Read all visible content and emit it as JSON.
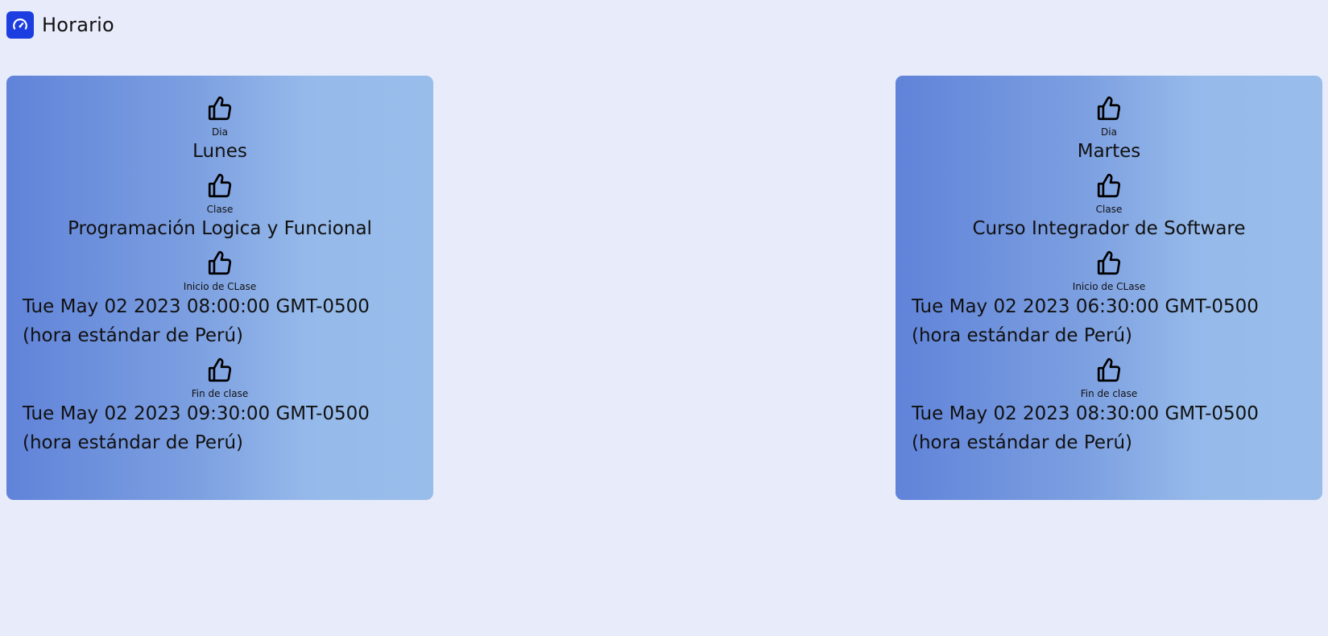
{
  "header": {
    "title": "Horario",
    "icon": "speedometer-icon",
    "icon_bg": "#1c3de0"
  },
  "cards": [
    {
      "dia_label": "Dia",
      "dia_value": "Lunes",
      "clase_label": "Clase",
      "clase_value": "Programación Logica y Funcional",
      "inicio_label": "Inicio de CLase",
      "inicio_value": "Tue May 02 2023 08:00:00 GMT-0500 (hora estándar de Perú)",
      "fin_label": "Fin de clase",
      "fin_value": "Tue May 02 2023 09:30:00 GMT-0500 (hora estándar de Perú)",
      "icon": "thumbs-up-icon"
    },
    {
      "dia_label": "Dia",
      "dia_value": "Martes",
      "clase_label": "Clase",
      "clase_value": "Curso Integrador de Software",
      "inicio_label": "Inicio de CLase",
      "inicio_value": "Tue May 02 2023 06:30:00 GMT-0500 (hora estándar de Perú)",
      "fin_label": "Fin de clase",
      "fin_value": "Tue May 02 2023 08:30:00 GMT-0500 (hora estándar de Perú)",
      "icon": "thumbs-up-icon"
    }
  ],
  "colors": {
    "background": "#e7ebfa",
    "card_gradient_start": "#6083d9",
    "card_gradient_end": "#99bdeb",
    "accent": "#1c3de0"
  }
}
